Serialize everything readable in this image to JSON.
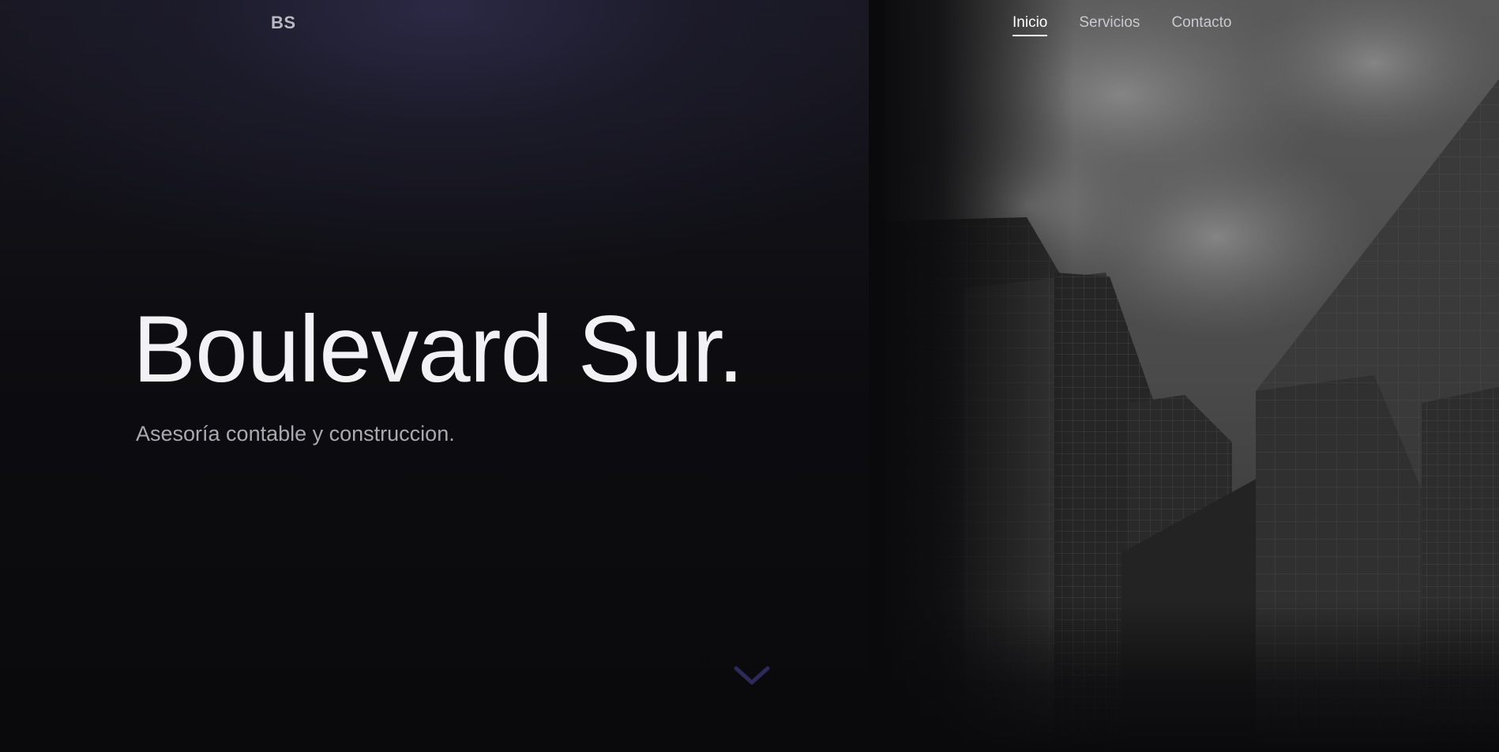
{
  "header": {
    "logo": "BS",
    "nav": [
      {
        "label": "Inicio",
        "active": true
      },
      {
        "label": "Servicios",
        "active": false
      },
      {
        "label": "Contacto",
        "active": false
      }
    ]
  },
  "hero": {
    "title": "Boulevard Sur.",
    "subtitle": "Asesoría contable y construccion."
  },
  "icons": {
    "scroll": "chevron-down-icon",
    "background": "buildings-photo"
  },
  "colors": {
    "background": "#0a0a0c",
    "gradient_top": "#2c2a46",
    "title": "#f2f2f5",
    "subtitle": "#a9a9b1",
    "chevron": "#2b2a5a"
  }
}
